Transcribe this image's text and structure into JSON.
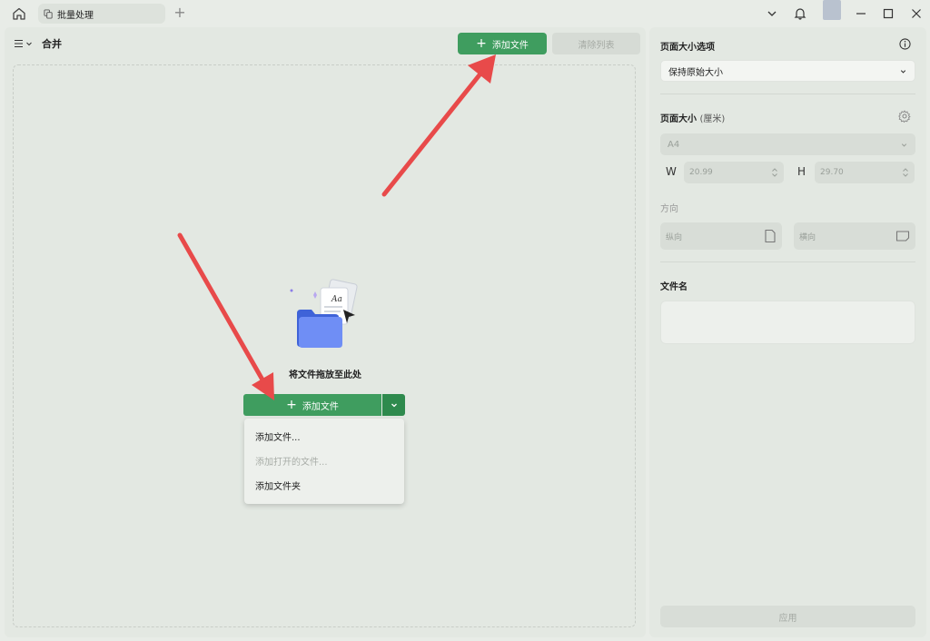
{
  "titlebar": {
    "tab_label": "批量处理",
    "icons": [
      "home-icon",
      "tab-document-icon",
      "plus-icon",
      "chevron-down-icon",
      "bell-icon",
      "minimize-icon",
      "maximize-icon",
      "close-icon"
    ]
  },
  "main": {
    "title": "合并",
    "add_file_label": "添加文件",
    "clear_list_label": "清除列表",
    "drop_text": "将文件拖放至此处",
    "split_add_label": "添加文件",
    "dropdown_items": [
      {
        "label": "添加文件...",
        "disabled": false
      },
      {
        "label": "添加打开的文件...",
        "disabled": true
      },
      {
        "label": "添加文件夹",
        "disabled": false
      }
    ]
  },
  "side": {
    "page_size_options_label": "页面大小选项",
    "page_size_option_value": "保持原始大小",
    "page_size_label": "页面大小",
    "page_size_unit": "(厘米)",
    "paper_value": "A4",
    "width_label": "W",
    "width_value": "20.99",
    "height_label": "H",
    "height_value": "29.70",
    "orientation_label": "方向",
    "portrait_label": "纵向",
    "landscape_label": "横向",
    "filename_label": "文件名",
    "apply_label": "应用"
  },
  "colors": {
    "accent": "#3f9d5f",
    "accent_dark": "#2e8a4d",
    "arrow": "#e84a4a",
    "panel_bg": "#e3e8e2"
  }
}
